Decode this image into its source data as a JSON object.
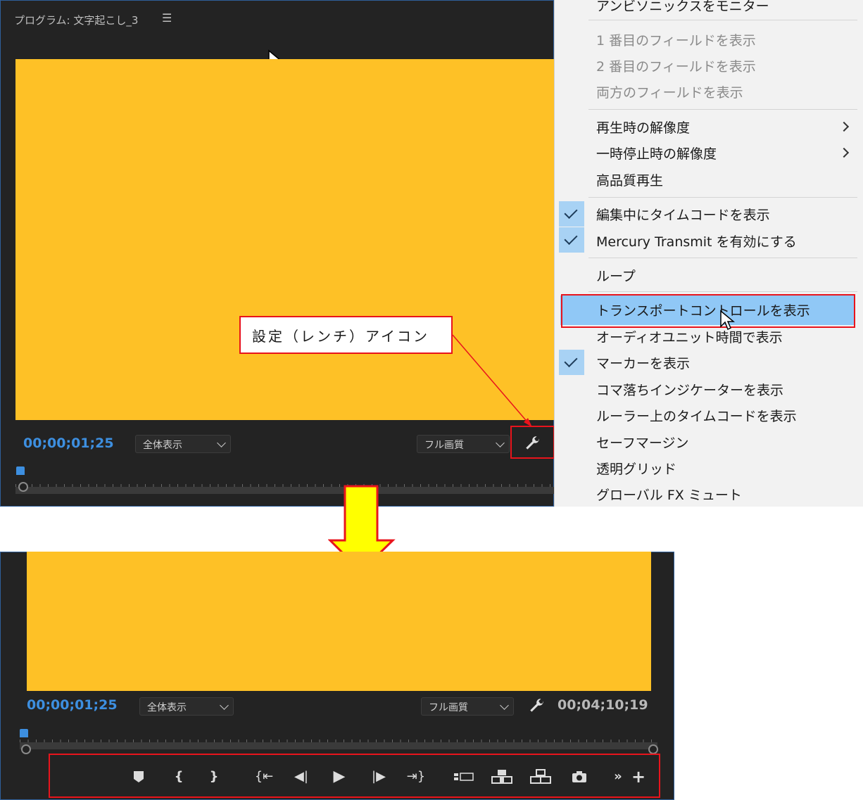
{
  "top_panel": {
    "title": "プログラム: 文字起こし_3",
    "timecode": "00;00;01;25",
    "zoom_select": "全体表示",
    "quality_select": "フル画質",
    "video_color": "#fec126"
  },
  "menu": {
    "items": [
      {
        "label": "アンビソニックスをモニター",
        "checked": false,
        "disabled": false
      },
      {
        "label": "1 番目のフィールドを表示",
        "checked": false,
        "disabled": true
      },
      {
        "label": "2 番目のフィールドを表示",
        "checked": false,
        "disabled": true
      },
      {
        "label": "両方のフィールドを表示",
        "checked": false,
        "disabled": true
      },
      {
        "label": "再生時の解像度",
        "checked": false,
        "submenu": true
      },
      {
        "label": "一時停止時の解像度",
        "checked": false,
        "submenu": true
      },
      {
        "label": "高品質再生",
        "checked": false
      },
      {
        "label": "編集中にタイムコードを表示",
        "checked": true
      },
      {
        "label": "Mercury Transmit を有効にする",
        "checked": true
      },
      {
        "label": "ループ",
        "checked": false
      },
      {
        "label": "トランスポートコントロールを表示",
        "checked": false,
        "highlighted": true
      },
      {
        "label": "オーディオユニット時間で表示",
        "checked": false
      },
      {
        "label": "マーカーを表示",
        "checked": true
      },
      {
        "label": "コマ落ちインジケーターを表示",
        "checked": false
      },
      {
        "label": "ルーラー上のタイムコードを表示",
        "checked": false
      },
      {
        "label": "セーフマージン",
        "checked": false
      },
      {
        "label": "透明グリッド",
        "checked": false
      },
      {
        "label": "グローバル FX ミュート",
        "checked": false
      }
    ]
  },
  "callout": {
    "text": "設定（レンチ）アイコン"
  },
  "bottom_panel": {
    "timecode": "00;00;01;25",
    "zoom_select": "全体表示",
    "quality_select": "フル画質",
    "duration": "00;04;10;19"
  },
  "transport_icons": [
    "marker-icon",
    "mark-in-icon",
    "mark-out-icon",
    "go-to-in-icon",
    "step-back-icon",
    "play-icon",
    "step-forward-icon",
    "go-to-out-icon",
    "lift-icon",
    "insert-icon",
    "overwrite-icon",
    "export-frame-icon",
    "more-icon",
    "add-button-icon"
  ],
  "colors": {
    "accent": "#3d8fe0",
    "annotation": "#e8141c",
    "highlight": "#90c8f6",
    "arrow": "#ffff00"
  }
}
